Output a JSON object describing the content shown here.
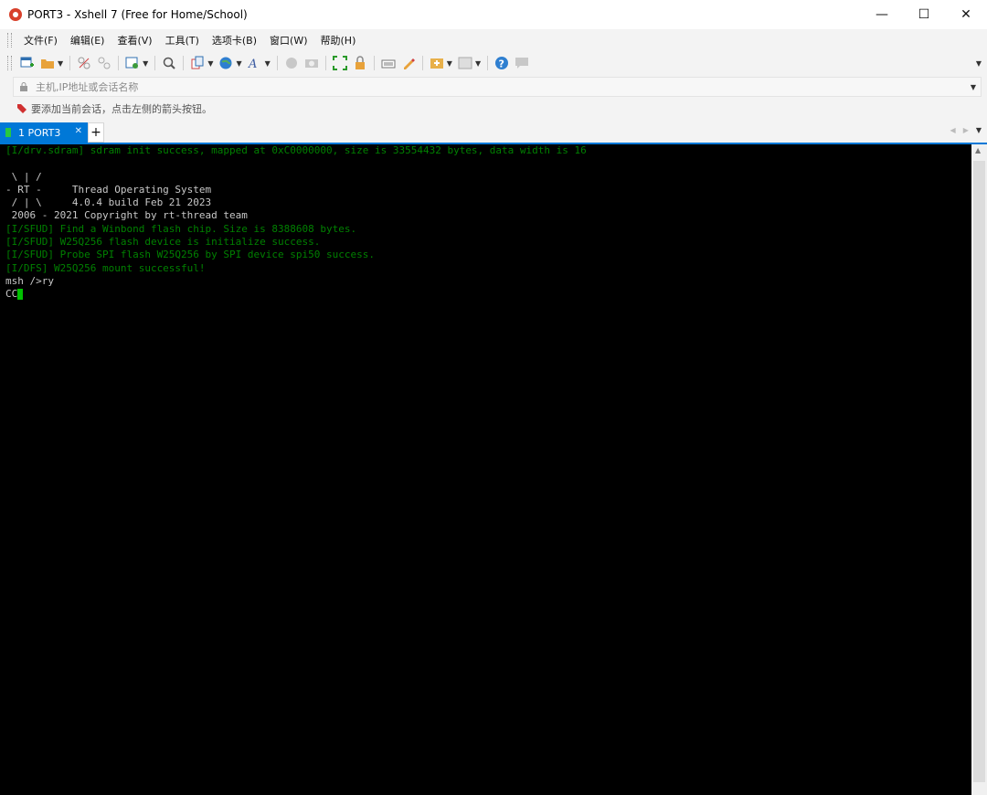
{
  "window": {
    "title": "PORT3 - Xshell 7 (Free for Home/School)",
    "controls": [
      "—",
      "☐",
      "✕"
    ]
  },
  "menu": {
    "items": [
      "文件(F)",
      "编辑(E)",
      "查看(V)",
      "工具(T)",
      "选项卡(B)",
      "窗口(W)",
      "帮助(H)"
    ]
  },
  "toolbar": {
    "icons": [
      "new-session-icon",
      "open-folder-icon",
      "disconnect-icon",
      "reconnect-icon",
      "properties-icon",
      "find-icon",
      "copy-icon",
      "globe-icon",
      "font-icon",
      "xftp-icon",
      "capture-icon",
      "fullscreen-icon",
      "lock-icon",
      "keyboard-icon",
      "highlight-icon",
      "script-icon",
      "layout-icon",
      "help-icon",
      "chat-icon"
    ]
  },
  "address": {
    "placeholder": "主机,IP地址或会话名称"
  },
  "hint": {
    "text": "要添加当前会话，点击左侧的箭头按钮。"
  },
  "tabs": [
    {
      "label": "1 PORT3",
      "active": true,
      "status_color": "#28c840"
    }
  ],
  "terminal": {
    "lines": [
      {
        "text": "[I/drv.sdram] sdram init success, mapped at 0xC0000000, size is 33554432 bytes, data width is 16",
        "color": "green"
      },
      {
        "text": "",
        "color": "white"
      },
      {
        "text": " \\ | /",
        "color": "white"
      },
      {
        "text": "- RT -     Thread Operating System",
        "color": "white"
      },
      {
        "text": " / | \\     4.0.4 build Feb 21 2023",
        "color": "white"
      },
      {
        "text": " 2006 - 2021 Copyright by rt-thread team",
        "color": "white"
      },
      {
        "text": "[I/SFUD] Find a Winbond flash chip. Size is 8388608 bytes.",
        "color": "green"
      },
      {
        "text": "[I/SFUD] W25Q256 flash device is initialize success.",
        "color": "green"
      },
      {
        "text": "[I/SFUD] Probe SPI flash W25Q256 by SPI device spi50 success.",
        "color": "green"
      },
      {
        "text": "[I/DFS] W25Q256 mount successful!",
        "color": "green"
      },
      {
        "text": "msh />ry",
        "color": "white"
      },
      {
        "text": "CC",
        "color": "white"
      }
    ],
    "cursor_line": 11
  },
  "colors": {
    "accent": "#0078d7",
    "terminal_bg": "#000000",
    "log_green": "#008000",
    "cursor_green": "#00c000"
  }
}
